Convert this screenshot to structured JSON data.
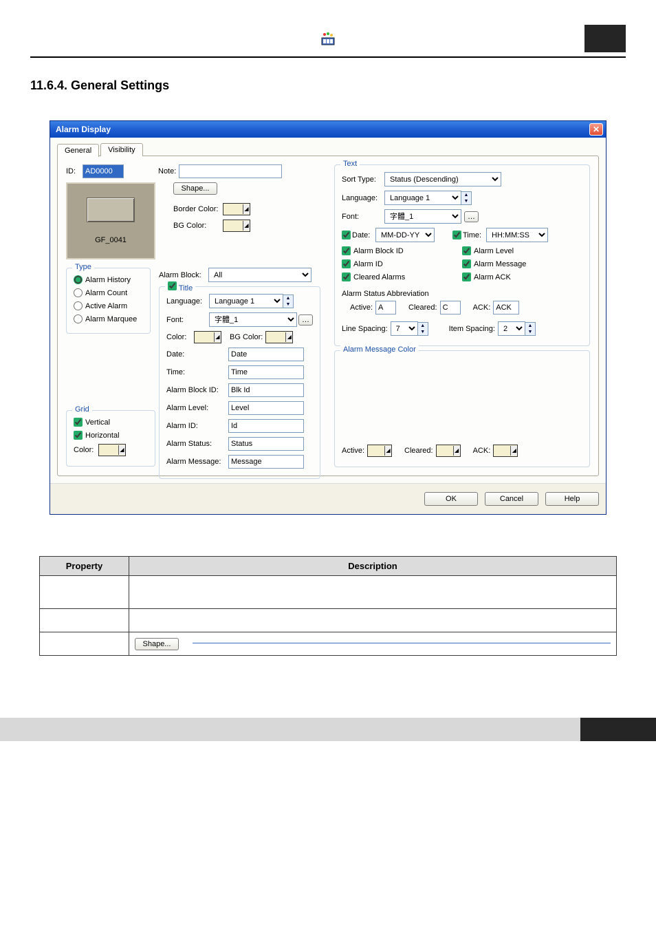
{
  "heading": "11.6.4. General Settings",
  "window": {
    "title": "Alarm Display",
    "tabs": {
      "general": "General",
      "visibility": "Visibility"
    },
    "id_label": "ID:",
    "id_value": "AD0000",
    "note_label": "Note:",
    "preview_name": "GF_0041",
    "shape_btn": "Shape...",
    "border_color_label": "Border Color:",
    "bg_color_label": "BG Color:",
    "alarm_block_label": "Alarm Block:",
    "alarm_block_value": "All",
    "type": {
      "legend": "Type",
      "options": [
        "Alarm History",
        "Alarm Count",
        "Active Alarm",
        "Alarm Marquee"
      ],
      "selected": 0
    },
    "title_group": {
      "legend": "Title",
      "checked": true,
      "language_label": "Language:",
      "language_value": "Language 1",
      "font_label": "Font:",
      "font_value": "字體_1",
      "color_label": "Color:",
      "bg_color_label": "BG Color:",
      "fields": [
        {
          "label": "Date:",
          "value": "Date"
        },
        {
          "label": "Time:",
          "value": "Time"
        },
        {
          "label": "Alarm Block ID:",
          "value": "Blk Id"
        },
        {
          "label": "Alarm Level:",
          "value": "Level"
        },
        {
          "label": "Alarm ID:",
          "value": "Id"
        },
        {
          "label": "Alarm Status:",
          "value": "Status"
        },
        {
          "label": "Alarm Message:",
          "value": "Message"
        }
      ]
    },
    "grid": {
      "legend": "Grid",
      "vertical": "Vertical",
      "horizontal": "Horizontal",
      "color_label": "Color:"
    },
    "text": {
      "legend": "Text",
      "sort_type_label": "Sort Type:",
      "sort_type_value": "Status (Descending)",
      "language_label": "Language:",
      "language_value": "Language 1",
      "font_label": "Font:",
      "font_value": "字體_1",
      "date_label": "Date:",
      "date_value": "MM-DD-YY",
      "time_label": "Time:",
      "time_value": "HH:MM:SS",
      "checks": {
        "alarm_block_id": "Alarm Block ID",
        "alarm_level": "Alarm Level",
        "alarm_id": "Alarm ID",
        "alarm_message": "Alarm Message",
        "cleared_alarms": "Cleared Alarms",
        "alarm_ack": "Alarm ACK"
      },
      "abbrev_label": "Alarm Status Abbreviation",
      "active_label": "Active:",
      "active_val": "A",
      "cleared_label": "Cleared:",
      "cleared_val": "C",
      "ack_label": "ACK:",
      "ack_val": "ACK",
      "line_spacing_label": "Line Spacing:",
      "line_spacing_val": "7",
      "item_spacing_label": "Item Spacing:",
      "item_spacing_val": "2"
    },
    "msg_color": {
      "legend": "Alarm Message Color",
      "active_label": "Active:",
      "cleared_label": "Cleared:",
      "ack_label": "ACK:"
    },
    "buttons": {
      "ok": "OK",
      "cancel": "Cancel",
      "help": "Help"
    }
  },
  "table": {
    "headers": [
      "Property",
      "Description"
    ],
    "shape_btn_cell": "Shape..."
  }
}
